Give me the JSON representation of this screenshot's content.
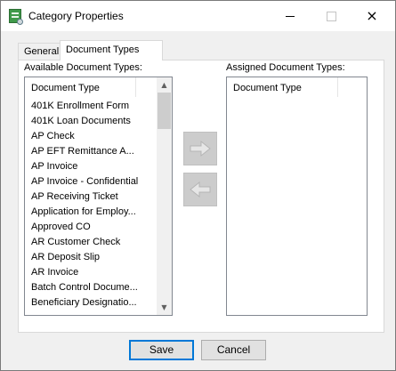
{
  "window": {
    "title": "Category Properties",
    "controls": {
      "minimize": "minimize",
      "maximize": "maximize",
      "close": "×"
    }
  },
  "tabs": [
    {
      "label": "General",
      "active": false
    },
    {
      "label": "Document Types",
      "active": true
    }
  ],
  "available": {
    "label": "Available Document Types:",
    "column_header": "Document Type",
    "items": [
      "401K Enrollment Form",
      "401K Loan Documents",
      "AP Check",
      "AP EFT Remittance A...",
      "AP Invoice",
      "AP Invoice - Confidential",
      "AP Receiving Ticket",
      "Application for Employ...",
      "Approved CO",
      "AR Customer Check",
      "AR Deposit Slip",
      "AR Invoice",
      "Batch Control Docume...",
      "Beneficiary Designatio..."
    ],
    "scrollbar": {
      "up": "▲",
      "down": "▼",
      "position": 0.0
    }
  },
  "assigned": {
    "label": "Assigned Document Types:",
    "column_header": "Document Type",
    "items": []
  },
  "move_buttons": {
    "add_icon": "arrow-right-icon",
    "remove_icon": "arrow-left-icon"
  },
  "buttons": {
    "save": "Save",
    "cancel": "Cancel"
  },
  "colors": {
    "accent": "#0078d7",
    "disabled_button": "#cccccc",
    "arrow": "#e6e6e6"
  }
}
